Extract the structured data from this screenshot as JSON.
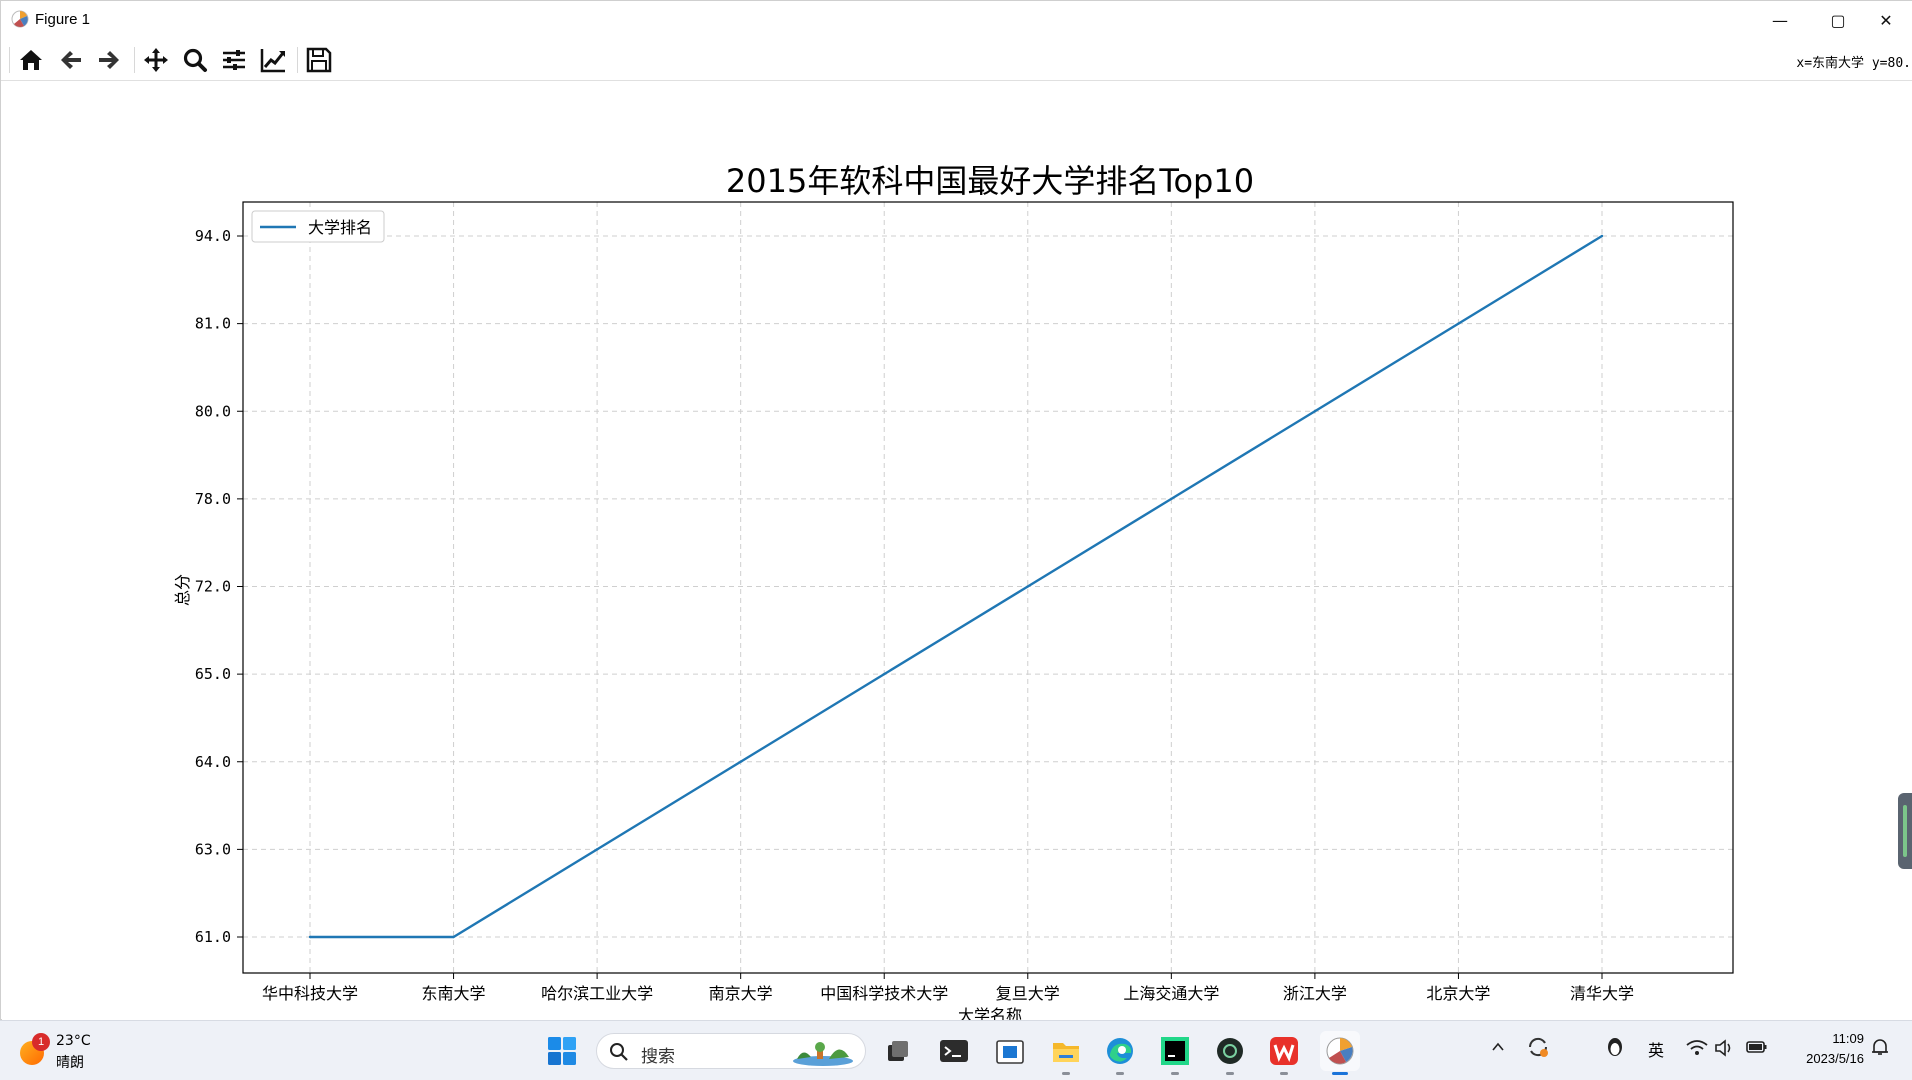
{
  "window": {
    "title": "Figure 1",
    "minimize_glyph": "—",
    "maximize_glyph": "▢",
    "close_glyph": "✕"
  },
  "toolbar": {
    "buttons": [
      "home-icon",
      "back-icon",
      "forward-icon",
      "pan-icon",
      "zoom-icon",
      "configure-subplots-icon",
      "edit-axis-icon",
      "save-icon"
    ],
    "coordinates": "x=东南大学 y=80."
  },
  "chart_data": {
    "type": "line",
    "title": "2015年软科中国最好大学排名Top10",
    "xlabel": "大学名称",
    "ylabel": "总分",
    "categories": [
      "华中科技大学",
      "东南大学",
      "哈尔滨工业大学",
      "南京大学",
      "中国科学技术大学",
      "复旦大学",
      "上海交通大学",
      "浙江大学",
      "北京大学",
      "清华大学"
    ],
    "y_tick_labels": [
      "61.0",
      "63.0",
      "64.0",
      "65.0",
      "72.0",
      "78.0",
      "80.0",
      "81.0",
      "94.0"
    ],
    "series": [
      {
        "name": "大学排名",
        "color": "#1f77b4",
        "values": [
          "61.0",
          "61.0",
          "63.0",
          "64.0",
          "65.0",
          "72.0",
          "78.0",
          "80.0",
          "81.0",
          "94.0"
        ]
      }
    ],
    "y_axis_is_categorical": true,
    "grid": true,
    "grid_style": "dashed",
    "legend_position": "upper-left"
  },
  "taskbar": {
    "weather_badge": "1",
    "weather_temp": "23°C",
    "weather_cond": "晴朗",
    "search_placeholder": "搜索",
    "apps": [
      "windows-start-icon",
      "task-view-icon",
      "terminal-icon",
      "store-icon",
      "file-explorer-icon",
      "edge-icon",
      "pycharm-icon",
      "ai-app-icon",
      "wps-icon",
      "matplotlib-figure-icon"
    ],
    "tray_ime": "英",
    "time": "11:09",
    "date": "2023/5/16"
  }
}
